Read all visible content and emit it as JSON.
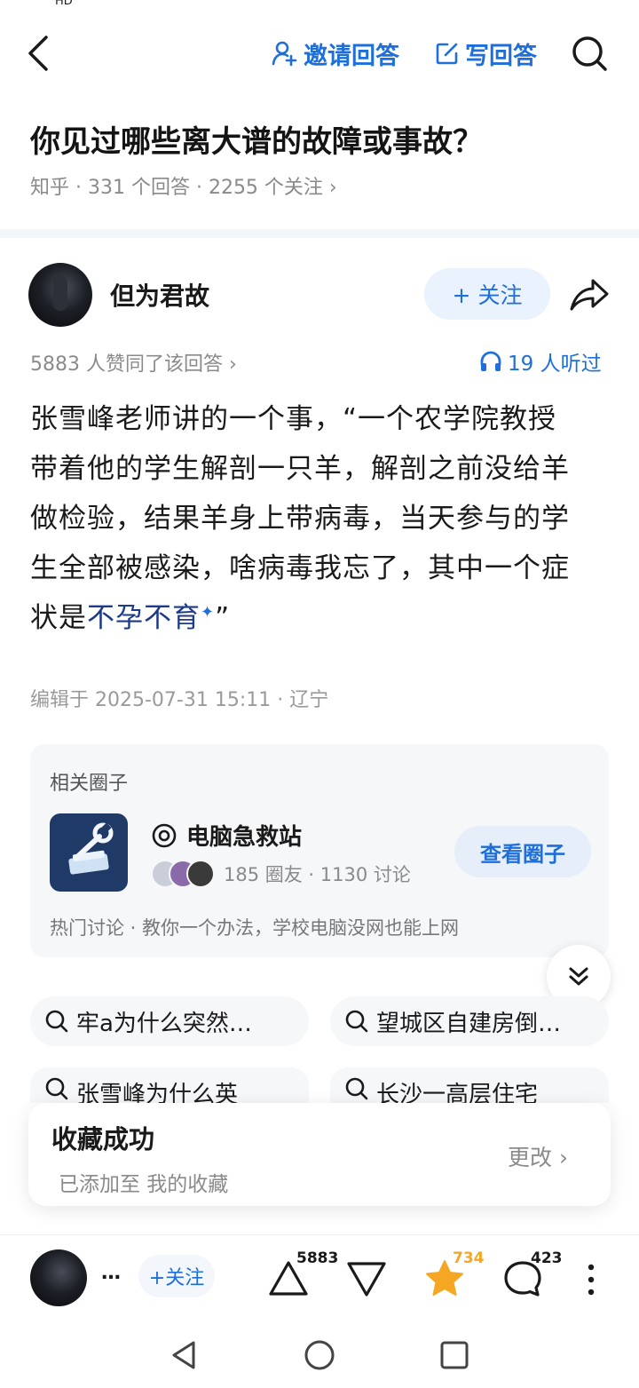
{
  "status_bar": {
    "left_text": "HD",
    "right_text": ""
  },
  "top_bar": {
    "invite_label": "邀请回答",
    "write_label": "写回答"
  },
  "question": {
    "title": "你见过哪些离大谱的故障或事故？",
    "meta": "知乎 · 331 个回答 · 2255 个关注 ›"
  },
  "answer": {
    "author": "但为君故",
    "follow_label": "+ 关注",
    "votes_line": "5883 人赞同了该回答 ›",
    "listened": "19 人听过",
    "content_lines": [
      "张雪峰老师讲的一个事，“一个农学院教授",
      "带着他的学生解剖一只羊，解剖之前没给羊",
      "做检验，结果羊身上带病毒，当天参与的学",
      "生全部被感染，啥病毒我忘了，其中一个症"
    ],
    "content_last_prefix": "状是",
    "content_highlight": "不孕不育",
    "content_last_suffix": "”",
    "edited": "编辑于 2025-07-31 15:11 · 辽宁"
  },
  "circle": {
    "header": "相关圈子",
    "name": "电脑急救站",
    "stats": "185 圈友 · 1130 讨论",
    "button_label": "查看圈子",
    "hot": "热门讨论 · 教你一个办法，学校电脑没网也能上网"
  },
  "related_searches": [
    "牢a为什么突然…",
    "望城区自建房倒…",
    "张雪峰为什么英",
    "长沙一高层住宅"
  ],
  "toast": {
    "title": "收藏成功",
    "subtitle": "已添加至 我的收藏",
    "action": "更改 ›"
  },
  "bottom_bar": {
    "author_short": "…",
    "follow_label": "+关注",
    "upvotes": "5883",
    "favorites": "734",
    "comments": "423"
  },
  "watermark": "",
  "colors": {
    "accent": "#1e6fd9",
    "favorite": "#f5a623",
    "text_primary": "#1a1a1a",
    "text_secondary": "#8a8a8a"
  },
  "icons": {
    "back": "chevron-left-icon",
    "invite": "user-plus-icon",
    "write": "edit-icon",
    "search": "search-icon",
    "share": "share-arrow-icon",
    "listen": "headphones-icon",
    "circle_badge": "circle-ring-icon",
    "expand": "double-chevron-down-icon",
    "upvote": "triangle-up-icon",
    "downvote": "triangle-down-icon",
    "favorite": "star-icon",
    "comment": "comment-bubble-icon",
    "more": "more-vertical-icon"
  }
}
